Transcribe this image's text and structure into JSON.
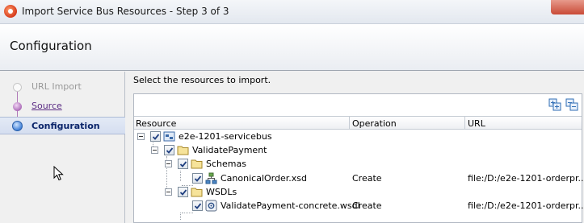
{
  "window": {
    "title": "Import Service Bus Resources - Step 3 of 3"
  },
  "header": {
    "title": "Configuration"
  },
  "steps": [
    {
      "label": "URL Import",
      "state": "disabled"
    },
    {
      "label": "Source",
      "state": "link"
    },
    {
      "label": "Configuration",
      "state": "current"
    }
  ],
  "content": {
    "instruction": "Select the resources to import.",
    "toolbar": {
      "expand_icon": "expand-all-icon",
      "collapse_icon": "collapse-all-icon"
    },
    "columns": [
      "Resource",
      "Operation",
      "URL"
    ],
    "rows": [
      {
        "level": 0,
        "name": "e2e-1201-servicebus",
        "icon": "project-icon",
        "checked": true,
        "operation": "",
        "url": ""
      },
      {
        "level": 1,
        "name": "ValidatePayment",
        "icon": "folder-icon",
        "checked": true,
        "operation": "",
        "url": ""
      },
      {
        "level": 2,
        "name": "Schemas",
        "icon": "folder-icon",
        "checked": true,
        "operation": "",
        "url": ""
      },
      {
        "level": 3,
        "name": "CanonicalOrder.xsd",
        "icon": "schema-icon",
        "checked": true,
        "operation": "Create",
        "url": "file:/D:/e2e-1201-orderpr..."
      },
      {
        "level": 2,
        "name": "WSDLs",
        "icon": "folder-icon",
        "checked": true,
        "operation": "",
        "url": ""
      },
      {
        "level": 3,
        "name": "ValidatePayment-concrete.wsdl",
        "icon": "wsdl-icon",
        "checked": true,
        "operation": "Create",
        "url": "file:/D:/e2e-1201-orderpr..."
      }
    ]
  },
  "colors": {
    "selected_step_bg": "#d5def0",
    "link": "#5b2c84",
    "accent": "#3a7bd5"
  }
}
